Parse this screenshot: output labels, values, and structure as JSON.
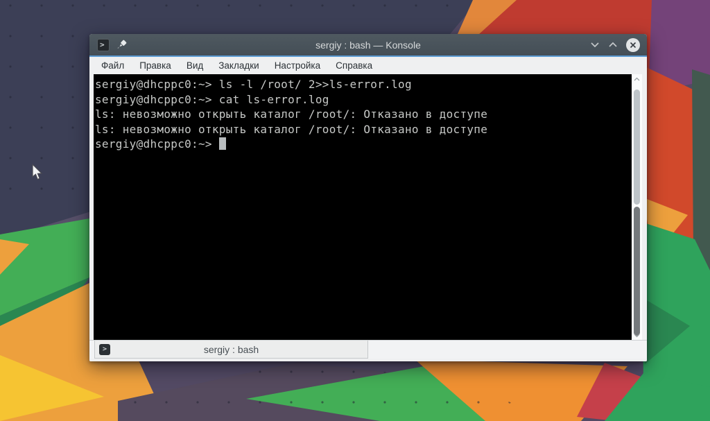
{
  "desktop": {
    "wallpaper_palette": {
      "base": "#534a64",
      "navy": "#3c3f56",
      "purple": "#575069",
      "violet": "#744379",
      "red": "#bf3b30",
      "red2": "#d1492b",
      "streak": "#e2873b",
      "teal": "#42594f",
      "orange": "#eda03d",
      "orange2": "#ef9032",
      "orange_deep": "#d8772b",
      "yellow": "#f6c432",
      "green": "#43ae56",
      "green_deep": "#2fa35c",
      "green_shade": "#2a8751",
      "band": "#554a5e",
      "crimson": "#c5404a"
    }
  },
  "colors": {
    "accent_line": "#5b9bd3",
    "titlebar_text": "#d6d9da",
    "menubar_bg": "#eff0f1",
    "menu_text": "#2b3136",
    "terminal_bg": "#000000",
    "terminal_text": "#c7c9c7",
    "cursor_color": "#b9bdbf",
    "scroll_track": "#fbfcfc",
    "scroll_handle_light": "#bec4c8",
    "scroll_handle_dark": "#75797c",
    "tabbar_bg": "#f2f3f4",
    "tab_bg": "#eceded",
    "tab_text": "#474e54",
    "close_btn_bg": "#e2e5e6"
  },
  "window": {
    "title": "sergiy : bash — Konsole",
    "titlebar": {
      "app_icon_glyph": ">"
    },
    "menubar": {
      "items": [
        "Файл",
        "Правка",
        "Вид",
        "Закладки",
        "Настройка",
        "Справка"
      ]
    },
    "terminal": {
      "lines": [
        {
          "text": "sergiy@dhcppc0:~> ls -l /root/ 2>>ls-error.log"
        },
        {
          "text": "sergiy@dhcppc0:~> cat ls-error.log"
        },
        {
          "text": "ls: невозможно открыть каталог /root/: Отказано в доступе"
        },
        {
          "text": "ls: невозможно открыть каталог /root/: Отказано в доступе"
        },
        {
          "text": "sergiy@dhcppc0:~>",
          "cursor": true
        }
      ]
    },
    "tabbar": {
      "tabs": [
        {
          "label": "sergiy : bash",
          "icon_glyph": ">"
        }
      ]
    }
  }
}
